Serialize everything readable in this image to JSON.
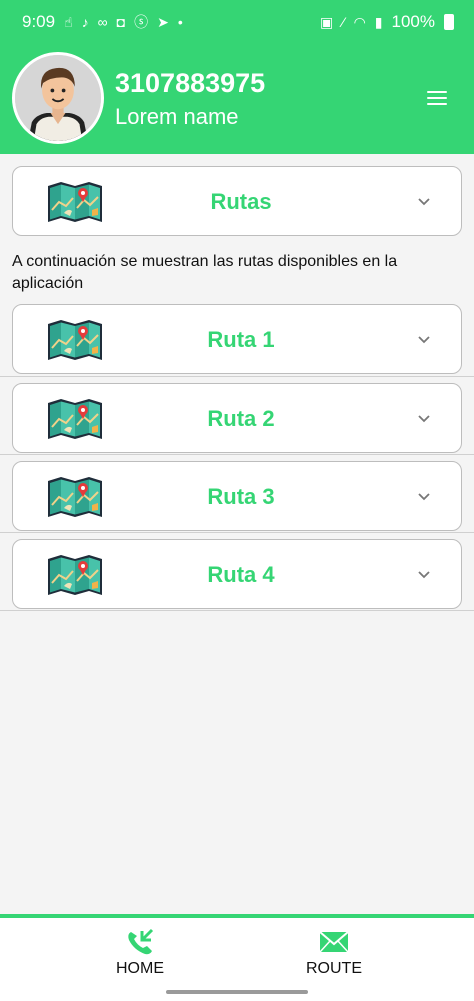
{
  "status_bar": {
    "time": "9:09",
    "battery": "100%"
  },
  "user": {
    "phone": "3107883975",
    "name": "Lorem name"
  },
  "header": {
    "menu_icon": "hamburger-menu-icon"
  },
  "rutas_card": {
    "title": "Rutas"
  },
  "description": "A continuación se muestran las rutas disponibles en la aplicación",
  "routes": [
    {
      "title": "Ruta 1"
    },
    {
      "title": "Ruta 2"
    },
    {
      "title": "Ruta 3"
    },
    {
      "title": "Ruta 4"
    }
  ],
  "bottom_nav": {
    "home_label": "HOME",
    "route_label": "ROUTE"
  },
  "colors": {
    "brand_green": "#35d574",
    "card_border": "#bdbdbd",
    "background": "#f4f4f4"
  }
}
